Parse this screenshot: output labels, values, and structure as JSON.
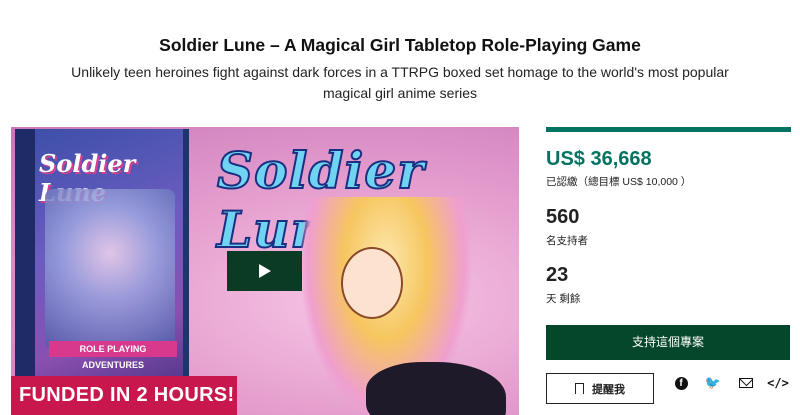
{
  "project": {
    "title": "Soldier Lune – A Magical Girl Tabletop Role-Playing Game",
    "blurb": "Unlikely teen heroines fight against dark forces in a TTRPG boxed set homage to the world's most popular magical girl anime series"
  },
  "media": {
    "logo_text": "Soldier Lune",
    "box_logo_text": "Soldier Lune",
    "box_banner_text": "ROLE PLAYING ADVENTURES",
    "funded_banner": "FUNDED IN 2 HOURS!",
    "play_icon": "play-icon"
  },
  "stats": {
    "accent_color": "#037362",
    "pledged_amount": "US$ 36,668",
    "pledged_label": "已認繳（總目標 US$ 10,000 ）",
    "backers_count": "560",
    "backers_label": "名支持者",
    "days_count": "23",
    "days_label": "天 剩餘"
  },
  "actions": {
    "back_label": "支持這個專案",
    "remind_label": "提醒我",
    "remind_icon": "bookmark-icon",
    "share_icons": [
      "facebook-icon",
      "twitter-icon",
      "email-icon",
      "embed-icon"
    ],
    "facebook_glyph": "f",
    "twitter_glyph": "🐦",
    "embed_glyph": "</>"
  }
}
